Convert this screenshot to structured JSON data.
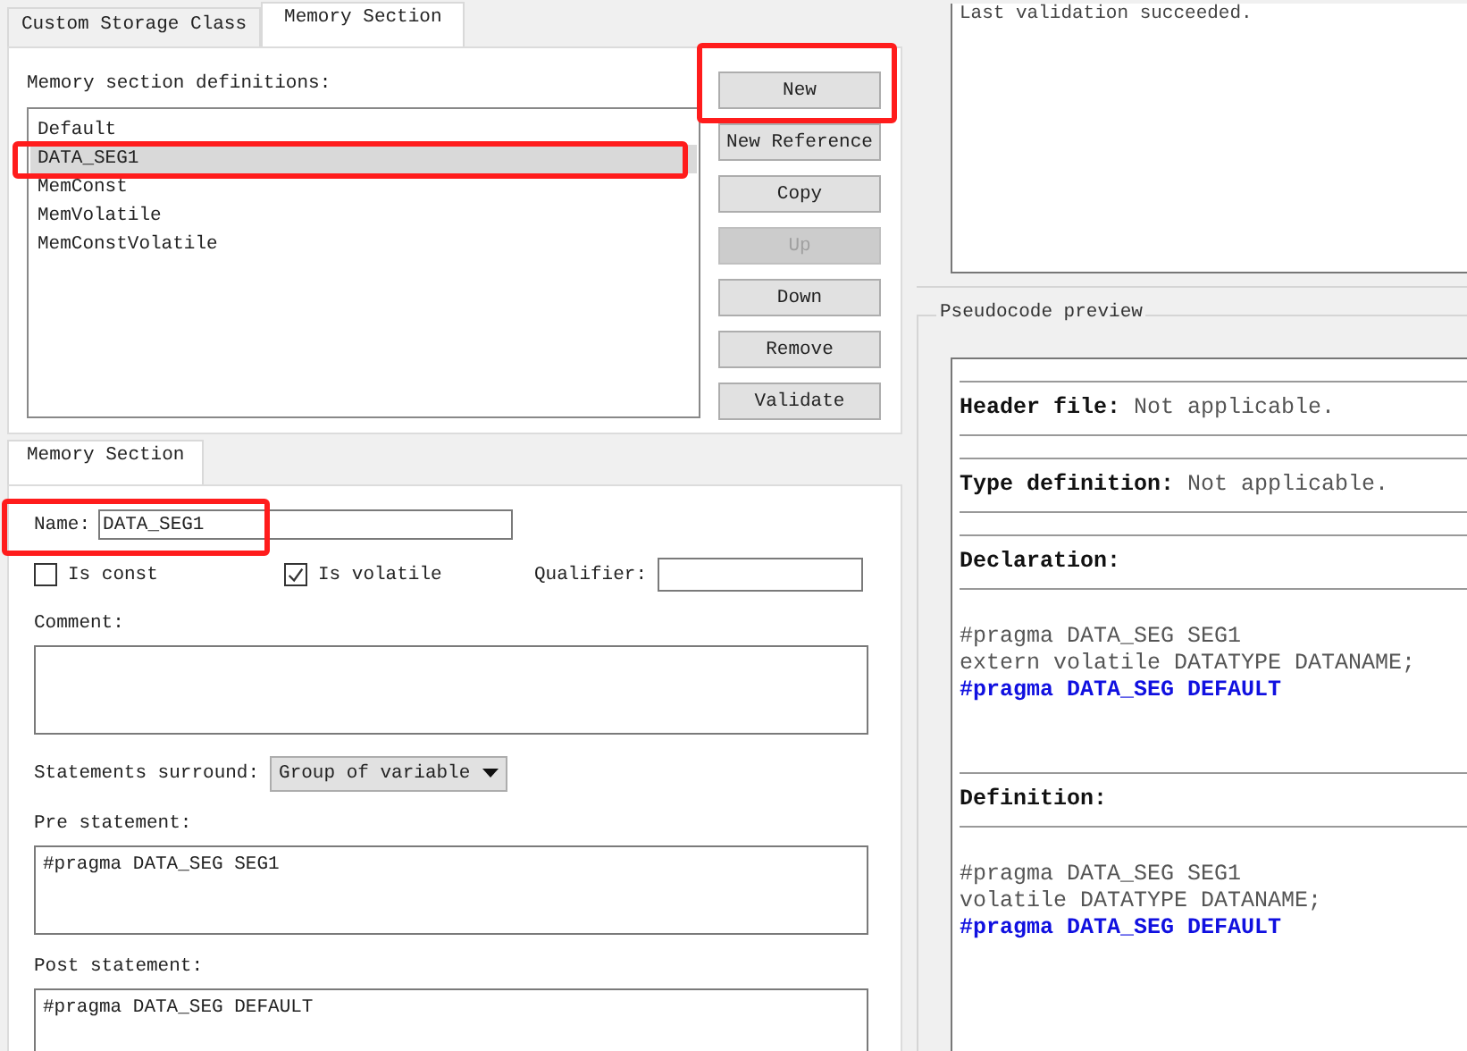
{
  "tabs": [
    {
      "label": "Custom Storage Class",
      "selected": false
    },
    {
      "label": "Memory Section",
      "selected": true
    }
  ],
  "definitions": {
    "label": "Memory section definitions:",
    "items": [
      {
        "text": "Default",
        "selected": false,
        "highlighted": false
      },
      {
        "text": "DATA_SEG1",
        "selected": true,
        "highlighted": true
      },
      {
        "text": "MemConst",
        "selected": false,
        "highlighted": false
      },
      {
        "text": "MemVolatile",
        "selected": false,
        "highlighted": false
      },
      {
        "text": "MemConstVolatile",
        "selected": false,
        "highlighted": false
      }
    ]
  },
  "buttons": [
    {
      "label": "New",
      "disabled": false,
      "highlighted": true
    },
    {
      "label": "New Reference",
      "disabled": false,
      "highlighted": false
    },
    {
      "label": "Copy",
      "disabled": false,
      "highlighted": false
    },
    {
      "label": "Up",
      "disabled": true,
      "highlighted": false
    },
    {
      "label": "Down",
      "disabled": false,
      "highlighted": false
    },
    {
      "label": "Remove",
      "disabled": false,
      "highlighted": false
    },
    {
      "label": "Validate",
      "disabled": false,
      "highlighted": false
    }
  ],
  "detail_tab": {
    "label": "Memory Section",
    "selected": true
  },
  "form": {
    "name_label": "Name:",
    "name_value": "DATA_SEG1",
    "name_highlighted": true,
    "is_const": {
      "label": "Is const",
      "checked": false
    },
    "is_volatile": {
      "label": "Is volatile",
      "checked": true
    },
    "qualifier_label": "Qualifier:",
    "comment_label": "Comment:",
    "surround_label": "Statements surround:",
    "surround_value": "Group of variable",
    "pre_label": "Pre statement:",
    "pre_value": "#pragma DATA_SEG SEG1",
    "post_label": "Post statement:",
    "post_value": "#pragma DATA_SEG DEFAULT"
  },
  "validation": {
    "message": "Last validation succeeded."
  },
  "preview": {
    "title": "Pseudocode preview",
    "sections": [
      {
        "kind": "inline",
        "text": "**Header file:** Not applicable."
      },
      {
        "kind": "inline",
        "text": "**Type definition:** Not applicable."
      },
      {
        "kind": "block",
        "heading": "Declaration:",
        "lines": [
          {
            "text": "#pragma DATA_SEG SEG1",
            "emphasis": false
          },
          {
            "text": "extern volatile DATATYPE DATANAME;",
            "emphasis": false
          },
          {
            "text": "#pragma DATA_SEG DEFAULT",
            "emphasis": true
          }
        ]
      },
      {
        "kind": "block",
        "heading": "Definition:",
        "lines": [
          {
            "text": "#pragma DATA_SEG SEG1",
            "emphasis": false
          },
          {
            "text": "volatile DATATYPE DATANAME;",
            "emphasis": false
          },
          {
            "text": "#pragma DATA_SEG DEFAULT",
            "emphasis": true
          }
        ]
      }
    ]
  }
}
